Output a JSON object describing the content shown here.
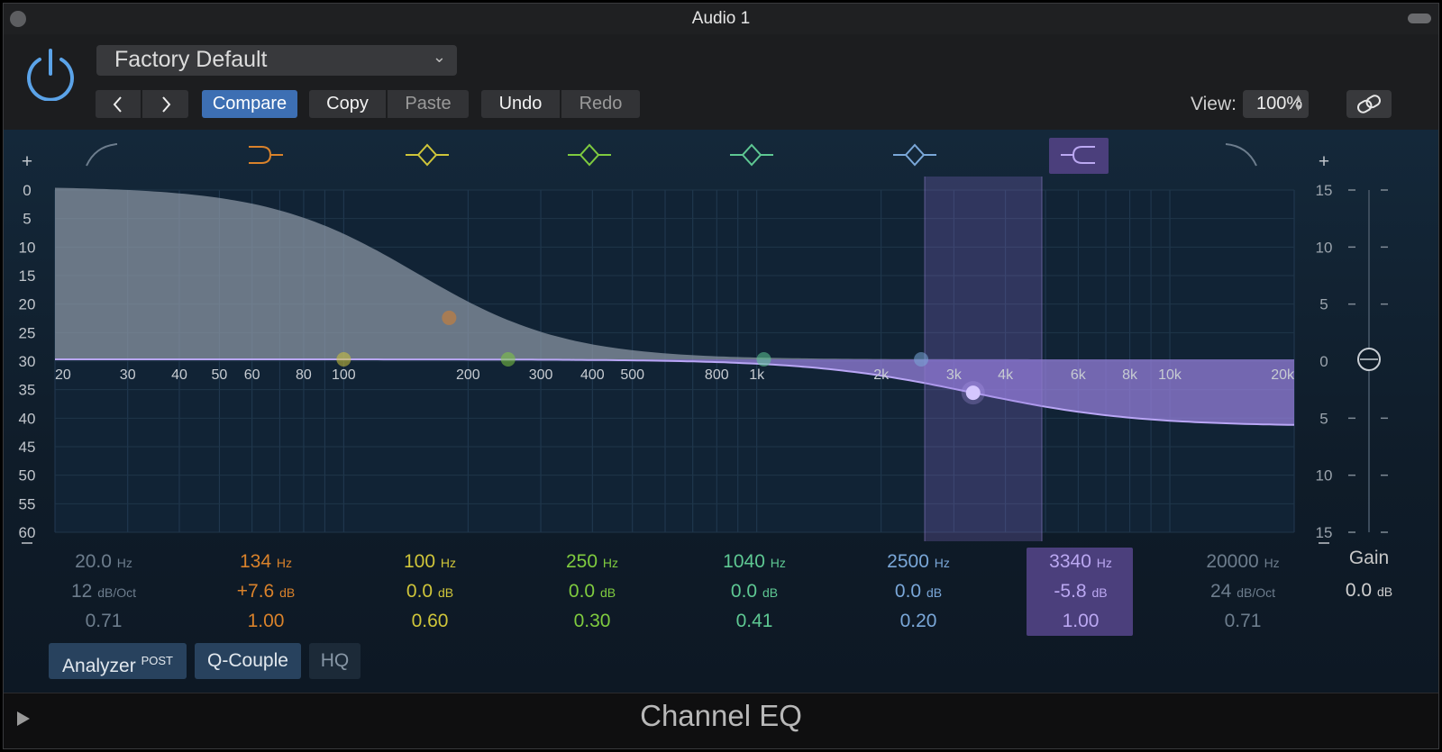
{
  "window": {
    "title": "Audio 1"
  },
  "header": {
    "preset": "Factory Default",
    "compare": "Compare",
    "copy": "Copy",
    "paste": "Paste",
    "undo": "Undo",
    "redo": "Redo",
    "view_label": "View:",
    "view_value": "100%"
  },
  "eq": {
    "left_plus": "+",
    "right_plus": "+",
    "analyzer_scale": [
      "0",
      "5",
      "10",
      "15",
      "20",
      "25",
      "30",
      "35",
      "40",
      "45",
      "50",
      "55",
      "60"
    ],
    "gain_scale": [
      "15",
      "10",
      "5",
      "0",
      "5",
      "10",
      "15"
    ],
    "freq_labels": [
      "20",
      "30",
      "40",
      "50",
      "60",
      "80",
      "100",
      "200",
      "300",
      "400",
      "500",
      "800",
      "1k",
      "2k",
      "3k",
      "4k",
      "6k",
      "8k",
      "10k",
      "20k"
    ],
    "bands": [
      {
        "freq": "20.0",
        "freq_unit": "Hz",
        "gain": "12",
        "gain_unit": "dB/Oct",
        "q": "0.71",
        "color": "#6d7d8d",
        "type_icon": "low-cut-icon"
      },
      {
        "freq": "134",
        "freq_unit": "Hz",
        "gain": "+7.6",
        "gain_unit": "dB",
        "q": "1.00",
        "color": "#d9822b",
        "type_icon": "low-shelf-icon"
      },
      {
        "freq": "100",
        "freq_unit": "Hz",
        "gain": "0.0",
        "gain_unit": "dB",
        "q": "0.60",
        "color": "#cfc53a",
        "type_icon": "peak-band-icon"
      },
      {
        "freq": "250",
        "freq_unit": "Hz",
        "gain": "0.0",
        "gain_unit": "dB",
        "q": "0.30",
        "color": "#7fcb3f",
        "type_icon": "peak-band-icon"
      },
      {
        "freq": "1040",
        "freq_unit": "Hz",
        "gain": "0.0",
        "gain_unit": "dB",
        "q": "0.41",
        "color": "#5ec893",
        "type_icon": "peak-band-icon"
      },
      {
        "freq": "2500",
        "freq_unit": "Hz",
        "gain": "0.0",
        "gain_unit": "dB",
        "q": "0.20",
        "color": "#7aa7d8",
        "type_icon": "peak-band-icon"
      },
      {
        "freq": "3340",
        "freq_unit": "Hz",
        "gain": "-5.8",
        "gain_unit": "dB",
        "q": "1.00",
        "color": "#bba8f2",
        "type_icon": "high-shelf-icon",
        "selected": true
      },
      {
        "freq": "20000",
        "freq_unit": "Hz",
        "gain": "24",
        "gain_unit": "dB/Oct",
        "q": "0.71",
        "color": "#6d7d8d",
        "type_icon": "high-cut-icon"
      }
    ],
    "gain_label": "Gain",
    "master_gain": "0.0",
    "master_gain_unit": "dB"
  },
  "options": {
    "analyzer": "Analyzer",
    "analyzer_mode": "POST",
    "q_couple": "Q-Couple",
    "hq": "HQ"
  },
  "footer": {
    "plugin_name": "Channel EQ"
  },
  "colors": {
    "accent_blue": "#3d6fb3",
    "selected_band": "#bba8f2"
  }
}
